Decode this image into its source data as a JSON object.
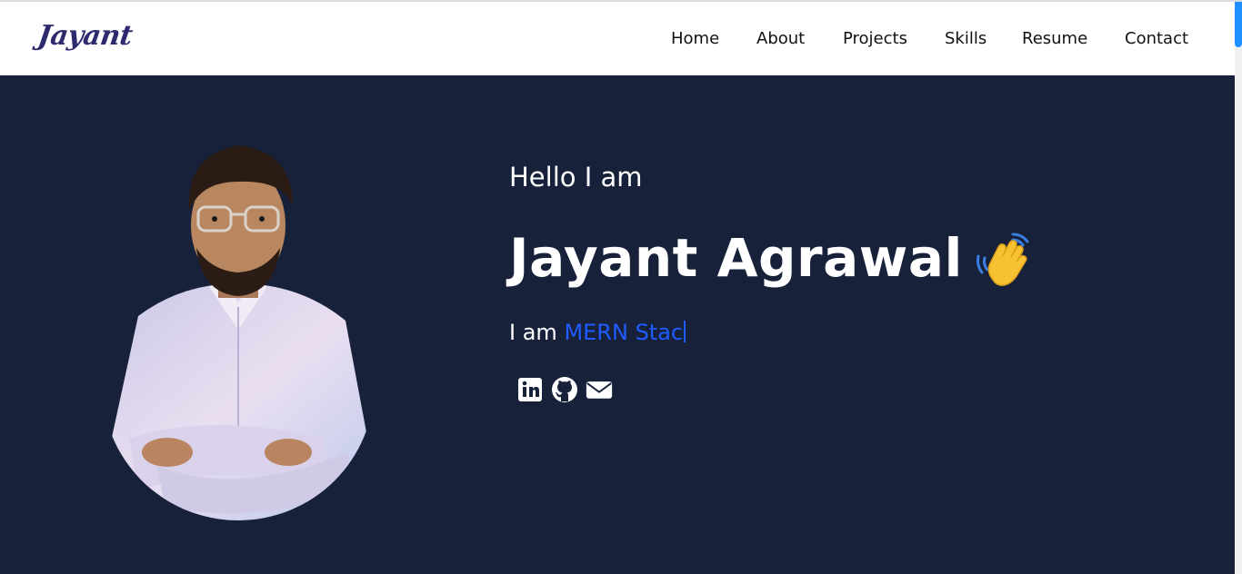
{
  "brand": {
    "logo_text": "Jayant"
  },
  "nav": {
    "items": [
      {
        "label": "Home"
      },
      {
        "label": "About"
      },
      {
        "label": "Projects"
      },
      {
        "label": "Skills"
      },
      {
        "label": "Resume"
      },
      {
        "label": "Contact"
      }
    ]
  },
  "hero": {
    "greeting": "Hello I am",
    "name": "Jayant Agrawal",
    "role_prefix": "I am",
    "role_typed": "MERN Stac",
    "wave_icon": "waving-hand-icon",
    "avatar_icon": "profile-photo-icon"
  },
  "social": {
    "icons": [
      "linkedin-icon",
      "github-icon",
      "mail-icon"
    ]
  },
  "colors": {
    "hero_background": "#17223a",
    "accent": "#1f5bff",
    "logo": "#2d2a6e"
  }
}
